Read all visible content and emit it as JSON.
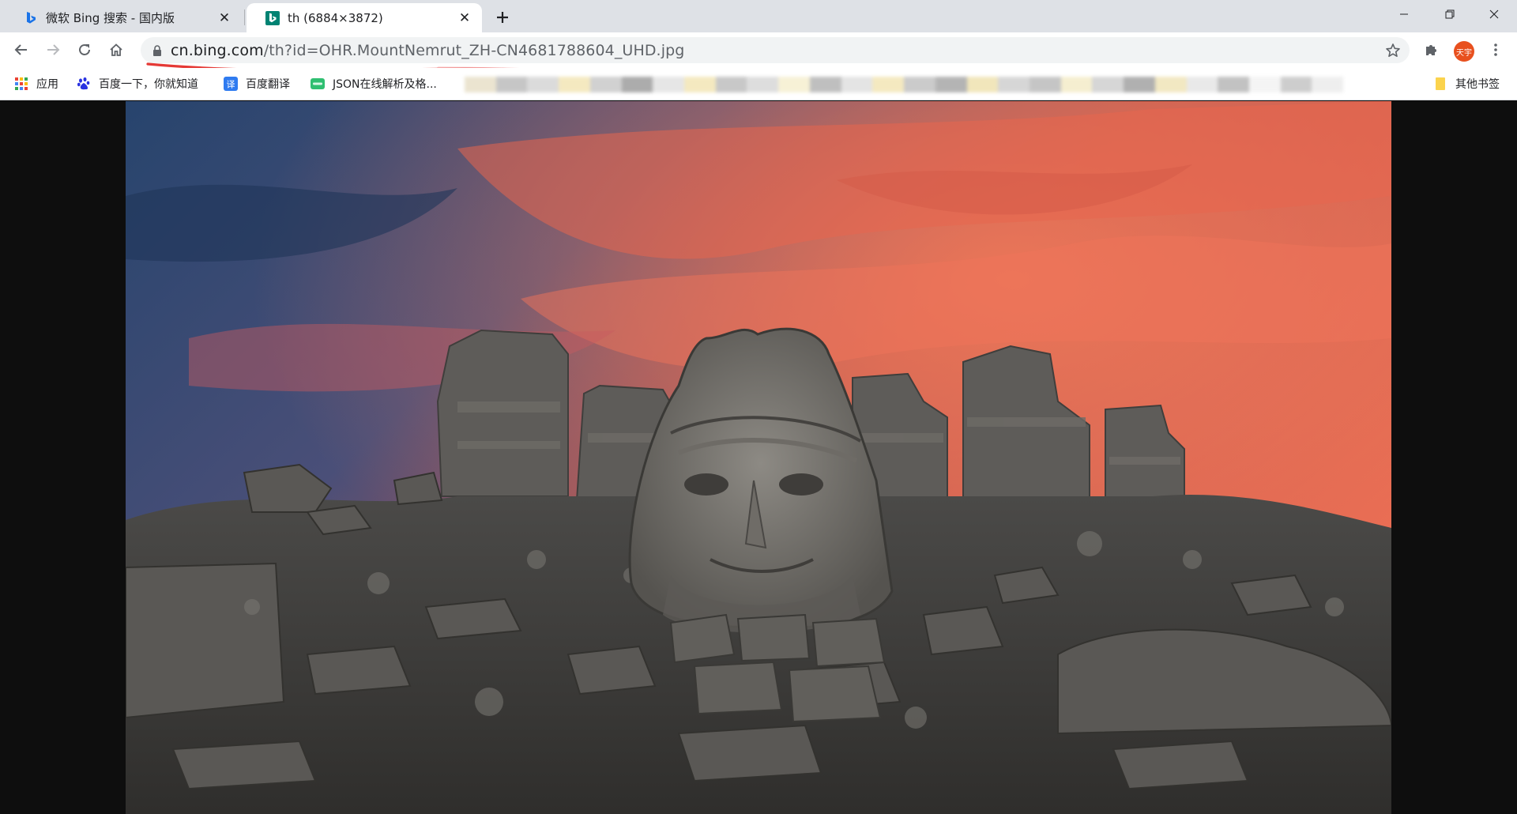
{
  "tabs": [
    {
      "title": "微软 Bing 搜索 - 国内版",
      "active": false
    },
    {
      "title": "th (6884×3872)",
      "active": true
    }
  ],
  "window": {
    "minimize_icon": "minimize-icon",
    "maximize_icon": "restore-icon",
    "close_icon": "close-icon"
  },
  "toolbar": {
    "url_host": "cn.bing.com",
    "url_path": "/th?id=OHR.MountNemrut_ZH-CN4681788604_UHD.jpg",
    "avatar_text": "天宇"
  },
  "bookmarks": {
    "items": [
      {
        "label": "应用",
        "icon": "apps-grid-icon"
      },
      {
        "label": "百度一下，你就知道",
        "icon": "baidu-paw-icon"
      },
      {
        "label": "百度翻译",
        "icon": "baidu-translate-icon"
      },
      {
        "label": "JSON在线解析及格...",
        "icon": "json-icon"
      }
    ],
    "other_label": "其他书签"
  },
  "colors": {
    "tabstrip": "#dee1e6",
    "accent_red": "#e53935",
    "bing_teal": "#008373",
    "avatar": "#e8501e"
  }
}
